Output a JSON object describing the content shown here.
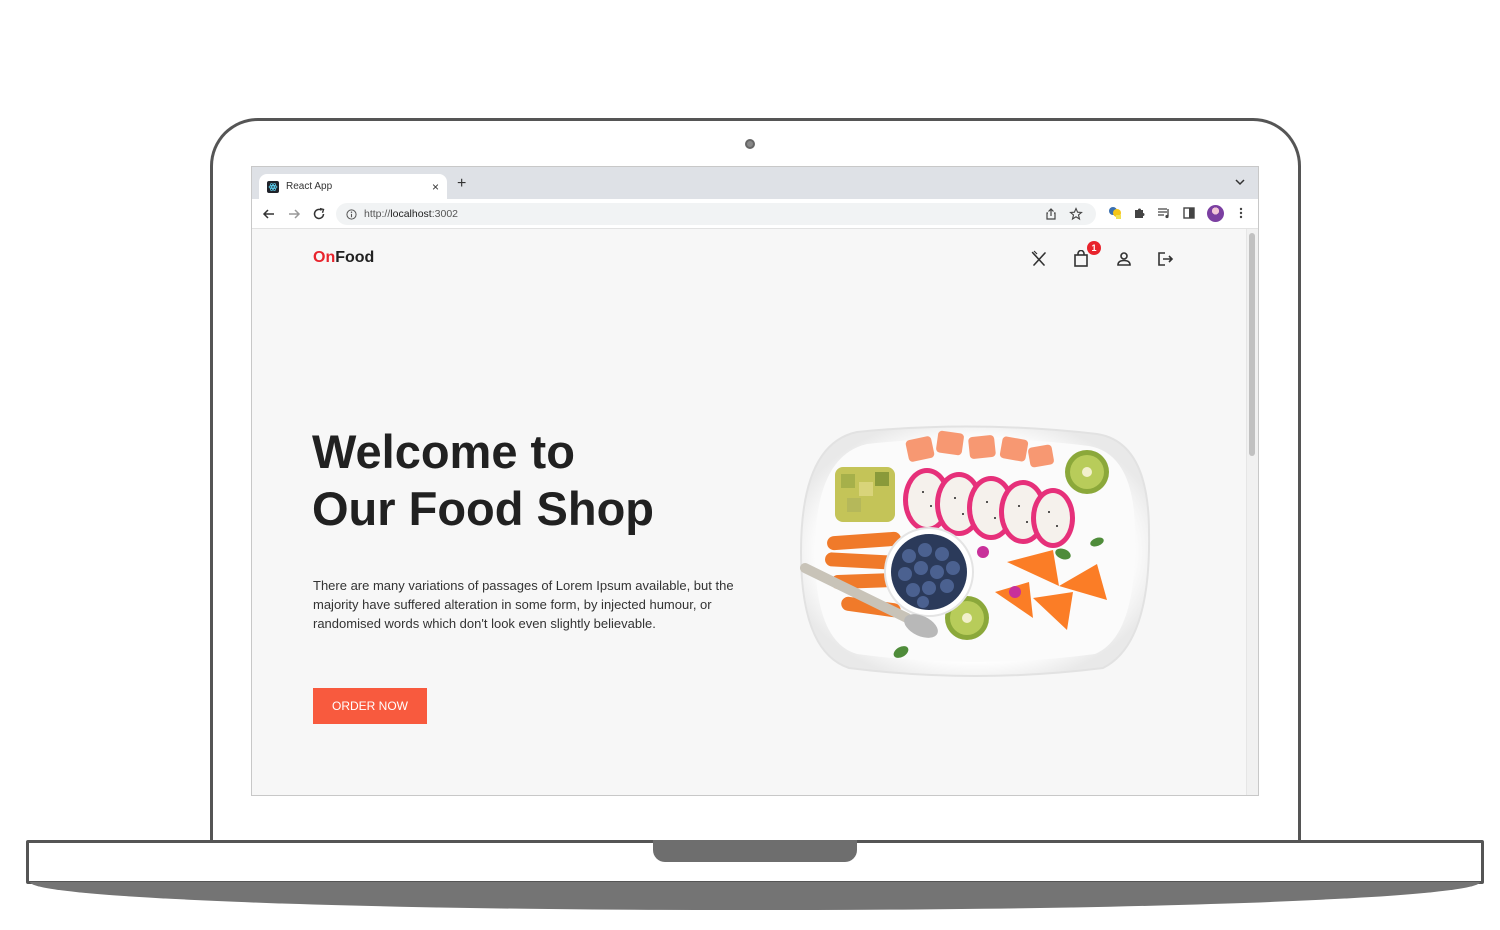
{
  "browser": {
    "tab_title": "React App",
    "tab_close": "×",
    "new_tab": "+",
    "url_scheme": "http://",
    "url_host": "localhost",
    "url_port": ":3002"
  },
  "site": {
    "logo_accent": "On",
    "logo_rest": "Food",
    "cart_count": "1",
    "colors": {
      "accent": "#e8232c",
      "button": "#f85a3e",
      "text": "#212121",
      "background": "#f7f7f7"
    }
  },
  "hero": {
    "title_line1": "Welcome to",
    "title_line2": "Our Food Shop",
    "description": "There are many variations of passages of Lorem Ipsum available, but the majority have suffered alteration in some form, by injected humour, or randomised words which don't look even slightly believable.",
    "cta_label": "ORDER NOW"
  },
  "icons": {
    "header": [
      "fork-knife-icon",
      "shopping-bag-icon",
      "user-icon",
      "logout-icon"
    ],
    "toolbar": [
      "back-arrow-icon",
      "forward-arrow-icon",
      "reload-icon",
      "info-icon",
      "share-icon",
      "star-icon",
      "extension-icon",
      "puzzle-icon",
      "media-icon",
      "sidebar-icon",
      "profile-avatar",
      "menu-dots-icon"
    ]
  }
}
